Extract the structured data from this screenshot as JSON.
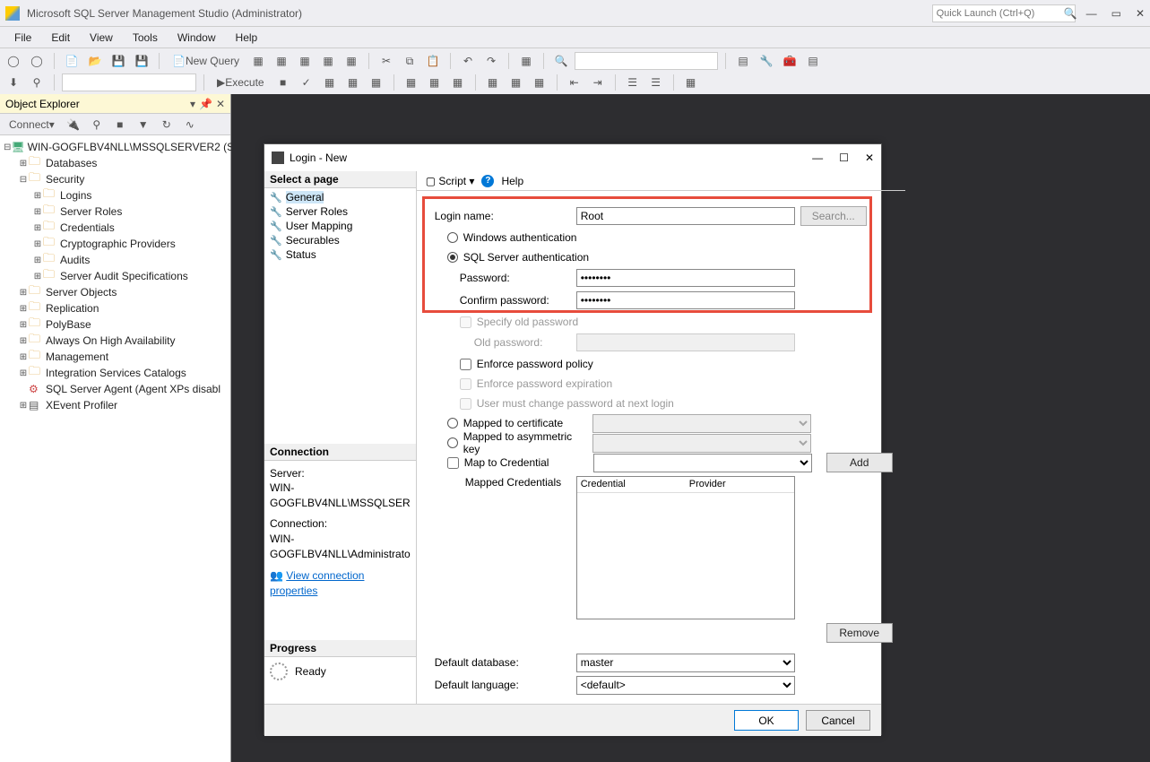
{
  "titlebar": {
    "title": "Microsoft SQL Server Management Studio (Administrator)",
    "quick_placeholder": "Quick Launch (Ctrl+Q)"
  },
  "menu": [
    "File",
    "Edit",
    "View",
    "Tools",
    "Window",
    "Help"
  ],
  "toolbar": {
    "new_query": "New Query",
    "execute": "Execute"
  },
  "objexp": {
    "title": "Object Explorer",
    "connect": "Connect",
    "server": "WIN-GOGFLBV4NLL\\MSSQLSERVER2 (S",
    "nodes": {
      "databases": "Databases",
      "security": "Security",
      "logins": "Logins",
      "server_roles": "Server Roles",
      "credentials": "Credentials",
      "crypto": "Cryptographic Providers",
      "audits": "Audits",
      "audit_spec": "Server Audit Specifications",
      "server_objects": "Server Objects",
      "replication": "Replication",
      "polybase": "PolyBase",
      "always_on": "Always On High Availability",
      "management": "Management",
      "isc": "Integration Services Catalogs",
      "agent": "SQL Server Agent (Agent XPs disabl",
      "xevent": "XEvent Profiler"
    }
  },
  "dialog": {
    "title": "Login - New",
    "select_page": "Select a page",
    "pages": {
      "general": "General",
      "server_roles": "Server Roles",
      "user_mapping": "User Mapping",
      "securables": "Securables",
      "status": "Status"
    },
    "toolbar": {
      "script": "Script",
      "help": "Help"
    },
    "form": {
      "login_name_label": "Login name:",
      "login_name": "Root",
      "search": "Search...",
      "win_auth": "Windows authentication",
      "sql_auth": "SQL Server authentication",
      "password_label": "Password:",
      "password": "••••••••",
      "confirm_label": "Confirm password:",
      "confirm": "••••••••",
      "specify_old": "Specify old password",
      "old_pwd_label": "Old password:",
      "enforce_policy": "Enforce password policy",
      "enforce_exp": "Enforce password expiration",
      "must_change": "User must change password at next login",
      "mapped_cert": "Mapped to certificate",
      "mapped_asym": "Mapped to asymmetric key",
      "map_cred": "Map to Credential",
      "add": "Add",
      "mapped_creds": "Mapped Credentials",
      "grid_credential": "Credential",
      "grid_provider": "Provider",
      "remove": "Remove",
      "def_db_label": "Default database:",
      "def_db": "master",
      "def_lang_label": "Default language:",
      "def_lang": "<default>"
    },
    "connection": {
      "title": "Connection",
      "server_label": "Server:",
      "server": "WIN-GOGFLBV4NLL\\MSSQLSER",
      "conn_label": "Connection:",
      "conn": "WIN-GOGFLBV4NLL\\Administrato",
      "view_props": "View connection properties"
    },
    "progress": {
      "title": "Progress",
      "status": "Ready"
    },
    "footer": {
      "ok": "OK",
      "cancel": "Cancel"
    }
  }
}
